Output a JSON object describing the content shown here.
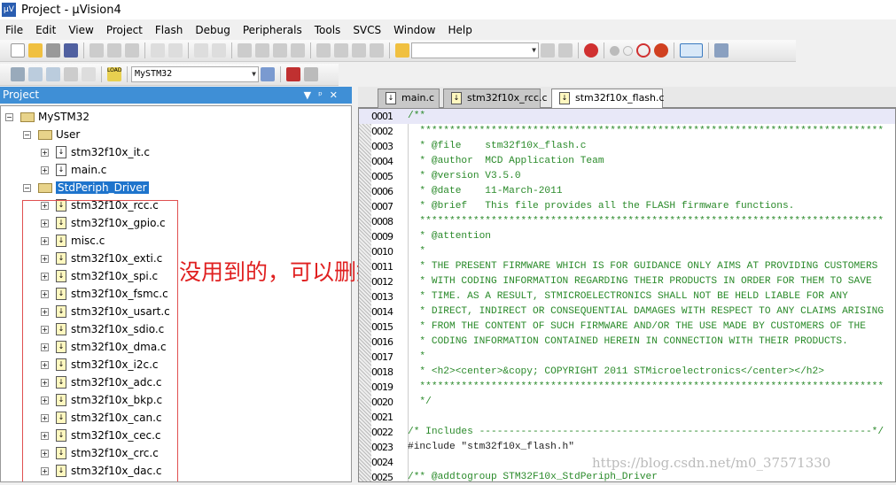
{
  "window": {
    "title": "Project  - µVision4"
  },
  "menu": [
    "File",
    "Edit",
    "View",
    "Project",
    "Flash",
    "Debug",
    "Peripherals",
    "Tools",
    "SVCS",
    "Window",
    "Help"
  ],
  "toolbar2": {
    "target": "MySTM32",
    "load_label": "LOAD"
  },
  "panel": {
    "title": "Project"
  },
  "tree": [
    {
      "label": "MySTM32",
      "level": 0,
      "type": "project"
    },
    {
      "label": "User",
      "level": 1,
      "type": "folder"
    },
    {
      "label": "stm32f10x_it.c",
      "level": 2,
      "type": "file"
    },
    {
      "label": "main.c",
      "level": 2,
      "type": "file"
    },
    {
      "label": "StdPeriph_Driver",
      "level": 1,
      "type": "folder",
      "selected": true
    },
    {
      "label": "stm32f10x_rcc.c",
      "level": 2,
      "type": "lib"
    },
    {
      "label": "stm32f10x_gpio.c",
      "level": 2,
      "type": "lib"
    },
    {
      "label": "misc.c",
      "level": 2,
      "type": "lib"
    },
    {
      "label": "stm32f10x_exti.c",
      "level": 2,
      "type": "lib"
    },
    {
      "label": "stm32f10x_spi.c",
      "level": 2,
      "type": "lib"
    },
    {
      "label": "stm32f10x_fsmc.c",
      "level": 2,
      "type": "lib"
    },
    {
      "label": "stm32f10x_usart.c",
      "level": 2,
      "type": "lib"
    },
    {
      "label": "stm32f10x_sdio.c",
      "level": 2,
      "type": "lib"
    },
    {
      "label": "stm32f10x_dma.c",
      "level": 2,
      "type": "lib"
    },
    {
      "label": "stm32f10x_i2c.c",
      "level": 2,
      "type": "lib"
    },
    {
      "label": "stm32f10x_adc.c",
      "level": 2,
      "type": "lib"
    },
    {
      "label": "stm32f10x_bkp.c",
      "level": 2,
      "type": "lib"
    },
    {
      "label": "stm32f10x_can.c",
      "level": 2,
      "type": "lib"
    },
    {
      "label": "stm32f10x_cec.c",
      "level": 2,
      "type": "lib"
    },
    {
      "label": "stm32f10x_crc.c",
      "level": 2,
      "type": "lib"
    },
    {
      "label": "stm32f10x_dac.c",
      "level": 2,
      "type": "lib"
    }
  ],
  "annotation": "没用到的，可以删掉",
  "tabs": [
    {
      "label": "main.c"
    },
    {
      "label": "stm32f10x_rcc.c"
    },
    {
      "label": "stm32f10x_flash.c",
      "active": true
    }
  ],
  "code": [
    {
      "no": "0001",
      "text": "/**",
      "cls": "c"
    },
    {
      "no": "0002",
      "text": "  ******************************************************************************",
      "cls": "c"
    },
    {
      "no": "0003",
      "text": "  * @file    stm32f10x_flash.c",
      "cls": "c"
    },
    {
      "no": "0004",
      "text": "  * @author  MCD Application Team",
      "cls": "c"
    },
    {
      "no": "0005",
      "text": "  * @version V3.5.0",
      "cls": "c"
    },
    {
      "no": "0006",
      "text": "  * @date    11-March-2011",
      "cls": "c"
    },
    {
      "no": "0007",
      "text": "  * @brief   This file provides all the FLASH firmware functions.",
      "cls": "c"
    },
    {
      "no": "0008",
      "text": "  ******************************************************************************",
      "cls": "c"
    },
    {
      "no": "0009",
      "text": "  * @attention",
      "cls": "c"
    },
    {
      "no": "0010",
      "text": "  *",
      "cls": "c"
    },
    {
      "no": "0011",
      "text": "  * THE PRESENT FIRMWARE WHICH IS FOR GUIDANCE ONLY AIMS AT PROVIDING CUSTOMERS",
      "cls": "c"
    },
    {
      "no": "0012",
      "text": "  * WITH CODING INFORMATION REGARDING THEIR PRODUCTS IN ORDER FOR THEM TO SAVE",
      "cls": "c"
    },
    {
      "no": "0013",
      "text": "  * TIME. AS A RESULT, STMICROELECTRONICS SHALL NOT BE HELD LIABLE FOR ANY",
      "cls": "c"
    },
    {
      "no": "0014",
      "text": "  * DIRECT, INDIRECT OR CONSEQUENTIAL DAMAGES WITH RESPECT TO ANY CLAIMS ARISING",
      "cls": "c"
    },
    {
      "no": "0015",
      "text": "  * FROM THE CONTENT OF SUCH FIRMWARE AND/OR THE USE MADE BY CUSTOMERS OF THE",
      "cls": "c"
    },
    {
      "no": "0016",
      "text": "  * CODING INFORMATION CONTAINED HEREIN IN CONNECTION WITH THEIR PRODUCTS.",
      "cls": "c"
    },
    {
      "no": "0017",
      "text": "  *",
      "cls": "c"
    },
    {
      "no": "0018",
      "text": "  * <h2><center>&copy; COPYRIGHT 2011 STMicroelectronics</center></h2>",
      "cls": "c"
    },
    {
      "no": "0019",
      "text": "  ******************************************************************************",
      "cls": "c"
    },
    {
      "no": "0020",
      "text": "  */",
      "cls": "c"
    },
    {
      "no": "0021",
      "text": "",
      "cls": "c"
    },
    {
      "no": "0022",
      "text": "/* Includes ------------------------------------------------------------------*/",
      "cls": "c"
    },
    {
      "no": "0023",
      "text": "#include \"stm32f10x_flash.h\"",
      "cls": "k"
    },
    {
      "no": "0024",
      "text": "",
      "cls": "c"
    },
    {
      "no": "0025",
      "text": "/** @addtogroup STM32F10x_StdPeriph_Driver",
      "cls": "c"
    }
  ],
  "watermark": "https://blog.csdn.net/m0_37571330"
}
